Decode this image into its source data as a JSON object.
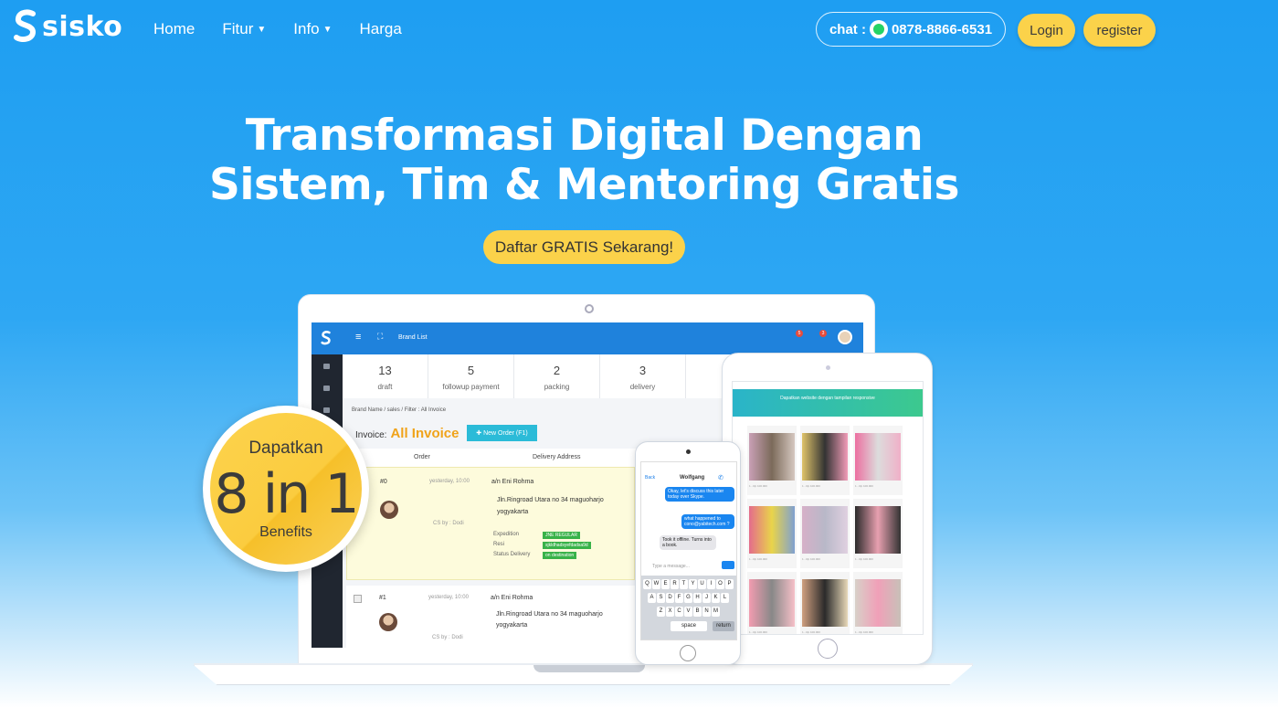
{
  "nav": {
    "brand": "sisko",
    "links": [
      {
        "label": "Home",
        "dropdown": false
      },
      {
        "label": "Fitur",
        "dropdown": true
      },
      {
        "label": "Info",
        "dropdown": true
      },
      {
        "label": "Harga",
        "dropdown": false
      }
    ],
    "chat_prefix": "chat :",
    "chat_phone": "0878-8866-6531",
    "login": "Login",
    "register": "register"
  },
  "hero": {
    "title_line1": "Transformasi Digital Dengan",
    "title_line2": "Sistem, Tim & Mentoring Gratis",
    "cta": "Daftar GRATIS Sekarang!"
  },
  "badge": {
    "top": "Dapatkan",
    "big": "8 in 1",
    "bottom": "Benefits"
  },
  "app": {
    "brand_list": "Brand List",
    "notif_1": "5",
    "notif_2": "3",
    "stats": [
      {
        "value": "13",
        "label": "draft"
      },
      {
        "value": "5",
        "label": "followup payment"
      },
      {
        "value": "2",
        "label": "packing"
      },
      {
        "value": "3",
        "label": "delivery"
      }
    ],
    "breadcrumb": "Brand Name / sales / Filter : All Invoice",
    "invoice_label": "Invoice:",
    "invoice_title": "All Invoice",
    "new_order": "New Order (F1)",
    "col_order": "Order",
    "col_address": "Delivery Address",
    "rows": [
      {
        "id": "#0",
        "time": "yesterday, 10:00",
        "name": "a/n Eni Rohma",
        "address1": "Jln.Ringroad Utara no 34 maguoharjo",
        "address2": "yogyakarta",
        "cs": "CS by : Dodi",
        "expedition_label": "Expedition",
        "expedition": "JNE REGULAR",
        "resi_label": "Resi",
        "resi": "sjkldhadsyefdadsa9d",
        "status_label": "Status Delivery",
        "status": "on destination"
      },
      {
        "id": "#1",
        "time": "yesterday, 10:00",
        "name": "a/n Eni Rohma",
        "address1": "Jln.Ringroad Utara no 34 maguoharjo",
        "address2": "yogyakarta",
        "cs": "CS by : Dodi"
      }
    ]
  },
  "phone": {
    "contact": "Wolfgang",
    "back": "Back",
    "msg1": "Okay, let's discuss this later today over Skype.",
    "msg2": "what happened to cono@yabitech.com ?",
    "msg3": "Took it offline. Turns into a book.",
    "placeholder": "Type a message...",
    "space": "space",
    "return": "return",
    "keys_row1": [
      "Q",
      "W",
      "E",
      "R",
      "T",
      "Y",
      "U",
      "I",
      "O",
      "P"
    ],
    "keys_row2": [
      "A",
      "S",
      "D",
      "F",
      "G",
      "H",
      "J",
      "K",
      "L"
    ],
    "keys_row3": [
      "Z",
      "X",
      "C",
      "V",
      "B",
      "N",
      "M"
    ]
  },
  "tablet": {
    "banner": "Dapatkan website dengan tampilan responsive",
    "prices": [
      "1 - Rp 100.000",
      "1 - Rp 100.000",
      "1 - Rp 100.000",
      "1 - Rp 100.000",
      "1 - Rp 100.000",
      "1 - Rp 100.000",
      "1 - Rp 100.000",
      "1 - Rp 100.000",
      "1 - Rp 100.000"
    ]
  },
  "colors": {
    "accent_yellow": "#fbd24a",
    "brand_blue": "#1f82dc",
    "invoice_orange": "#f0a31a",
    "whatsapp_green": "#25d366"
  }
}
